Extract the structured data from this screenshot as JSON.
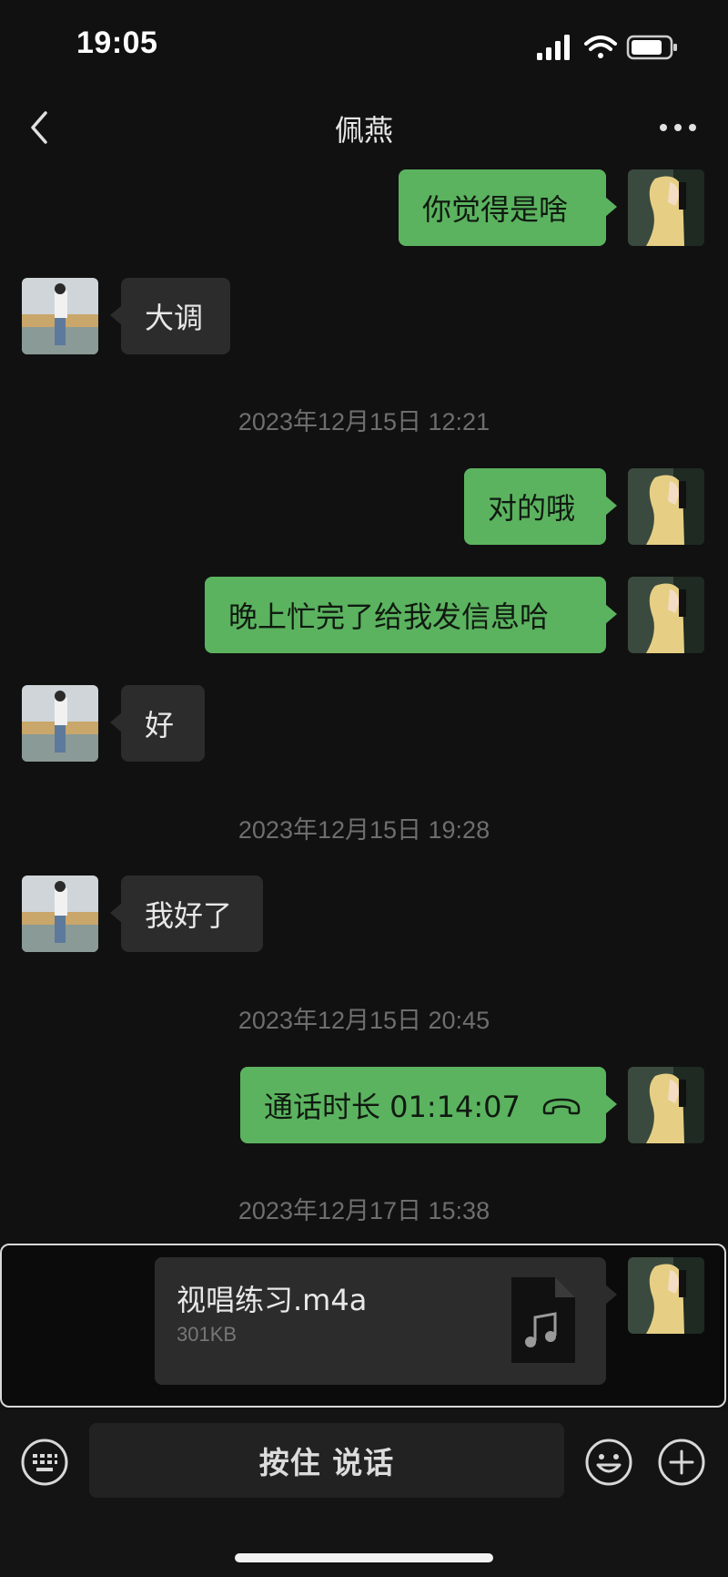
{
  "status_bar": {
    "time": "19:05",
    "icons": [
      "signal-icon",
      "wifi-icon",
      "battery-icon"
    ]
  },
  "header": {
    "title": "佩燕",
    "back_icon": "chevron-left-icon",
    "more_icon": "more-dots-icon"
  },
  "messages": [
    {
      "sender": "me",
      "text": "你觉得是啥"
    },
    {
      "sender": "other",
      "text": "大调"
    },
    {
      "type": "timestamp",
      "text": "2023年12月15日 12:21"
    },
    {
      "sender": "me",
      "text": "对的哦"
    },
    {
      "sender": "me",
      "text": "晚上忙完了给我发信息哈"
    },
    {
      "sender": "other",
      "text": "好"
    },
    {
      "type": "timestamp",
      "text": "2023年12月15日 19:28"
    },
    {
      "sender": "other",
      "text": "我好了"
    },
    {
      "type": "timestamp",
      "text": "2023年12月15日 20:45"
    },
    {
      "sender": "me",
      "type": "call",
      "text": "通话时长 01:14:07",
      "icon": "phone-hangup-icon"
    },
    {
      "type": "timestamp",
      "text": "2023年12月17日 15:38"
    },
    {
      "sender": "me",
      "type": "file",
      "file_name": "视唱练习.m4a",
      "file_size": "301KB",
      "icon": "music-file-icon"
    }
  ],
  "input_bar": {
    "voice_label": "按住 说话",
    "keyboard_icon": "keyboard-icon",
    "emoji_icon": "emoji-icon",
    "plus_icon": "plus-icon"
  },
  "colors": {
    "background": "#111111",
    "outgoing_bubble": "#5bb35f",
    "incoming_bubble": "#2c2c2c"
  }
}
